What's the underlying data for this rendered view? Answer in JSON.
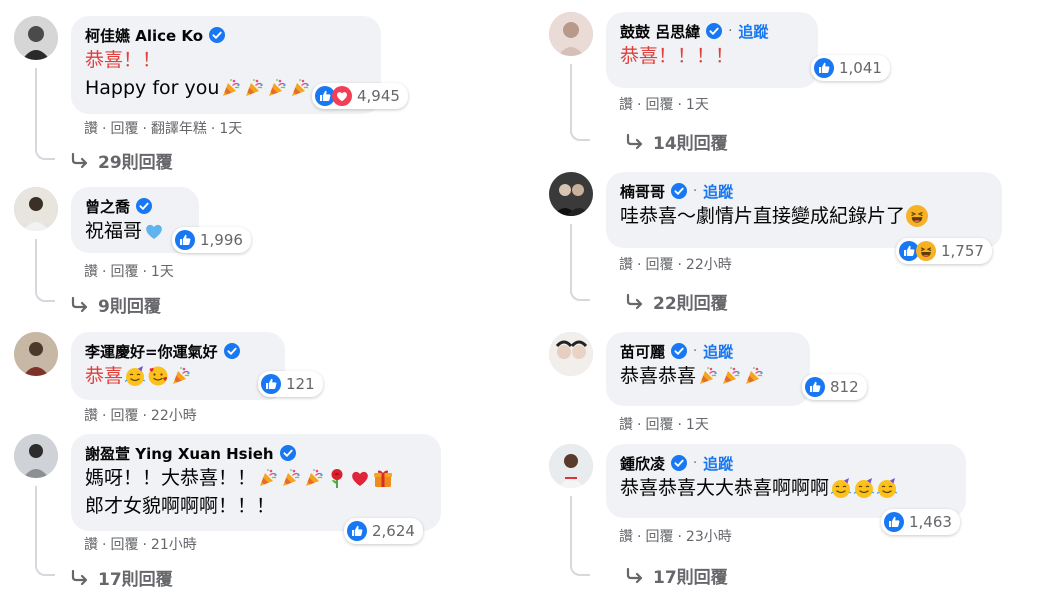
{
  "comments_left": [
    {
      "name": "柯佳嬿 Alice Ko",
      "line1": "恭喜！！",
      "line2": "Happy for you",
      "reaction_count": "4,945",
      "actions": [
        "讚",
        "回覆",
        "翻譯年糕",
        "1天"
      ],
      "replies": "29則回覆"
    },
    {
      "name": "曾之喬",
      "line1": "祝福哥",
      "reaction_count": "1,996",
      "actions": [
        "讚",
        "回覆",
        "1天"
      ],
      "replies": "9則回覆"
    },
    {
      "name": "李運慶好=你運氣好",
      "line1": "恭喜",
      "reaction_count": "121",
      "actions": [
        "讚",
        "回覆",
        "22小時"
      ]
    },
    {
      "name": "謝盈萱 Ying Xuan Hsieh",
      "line1": "媽呀！！大恭喜！！",
      "line2": "郎才女貌啊啊啊！！！",
      "reaction_count": "2,624",
      "actions": [
        "讚",
        "回覆",
        "21小時"
      ],
      "replies": "17則回覆"
    }
  ],
  "comments_right": [
    {
      "name": "鼓鼓 呂思緯",
      "follow": "追蹤",
      "line1": "恭喜！！！！",
      "reaction_count": "1,041",
      "actions": [
        "讚",
        "回覆",
        "1天"
      ],
      "replies": "14則回覆"
    },
    {
      "name": "楠哥哥",
      "follow": "追蹤",
      "line1": "哇恭喜～劇情片直接變成紀錄片了",
      "reaction_count": "1,757",
      "actions": [
        "讚",
        "回覆",
        "22小時"
      ],
      "replies": "22則回覆"
    },
    {
      "name": "苗可麗",
      "follow": "追蹤",
      "line1": "恭喜恭喜",
      "reaction_count": "812",
      "actions": [
        "讚",
        "回覆",
        "1天"
      ]
    },
    {
      "name": "鍾欣凌",
      "follow": "追蹤",
      "line1": "恭喜恭喜大大恭喜啊啊啊",
      "reaction_count": "1,463",
      "actions": [
        "讚",
        "回覆",
        "23小時"
      ],
      "replies": "17則回覆"
    }
  ],
  "dot": "·",
  "colors": {
    "like_blue": "#1877f2",
    "bubble_bg": "#f0f2f5",
    "meta_gray": "#65676b",
    "red_text": "#e0403c"
  },
  "icons": [
    "verified-badge-icon",
    "like-reaction-icon",
    "love-reaction-icon",
    "haha-reaction-icon",
    "party-popper-icon",
    "blue-heart-icon",
    "smiling-face-with-hearts-icon",
    "partying-face-icon",
    "rose-icon",
    "red-heart-icon",
    "gift-icon",
    "reply-arrow-icon"
  ]
}
